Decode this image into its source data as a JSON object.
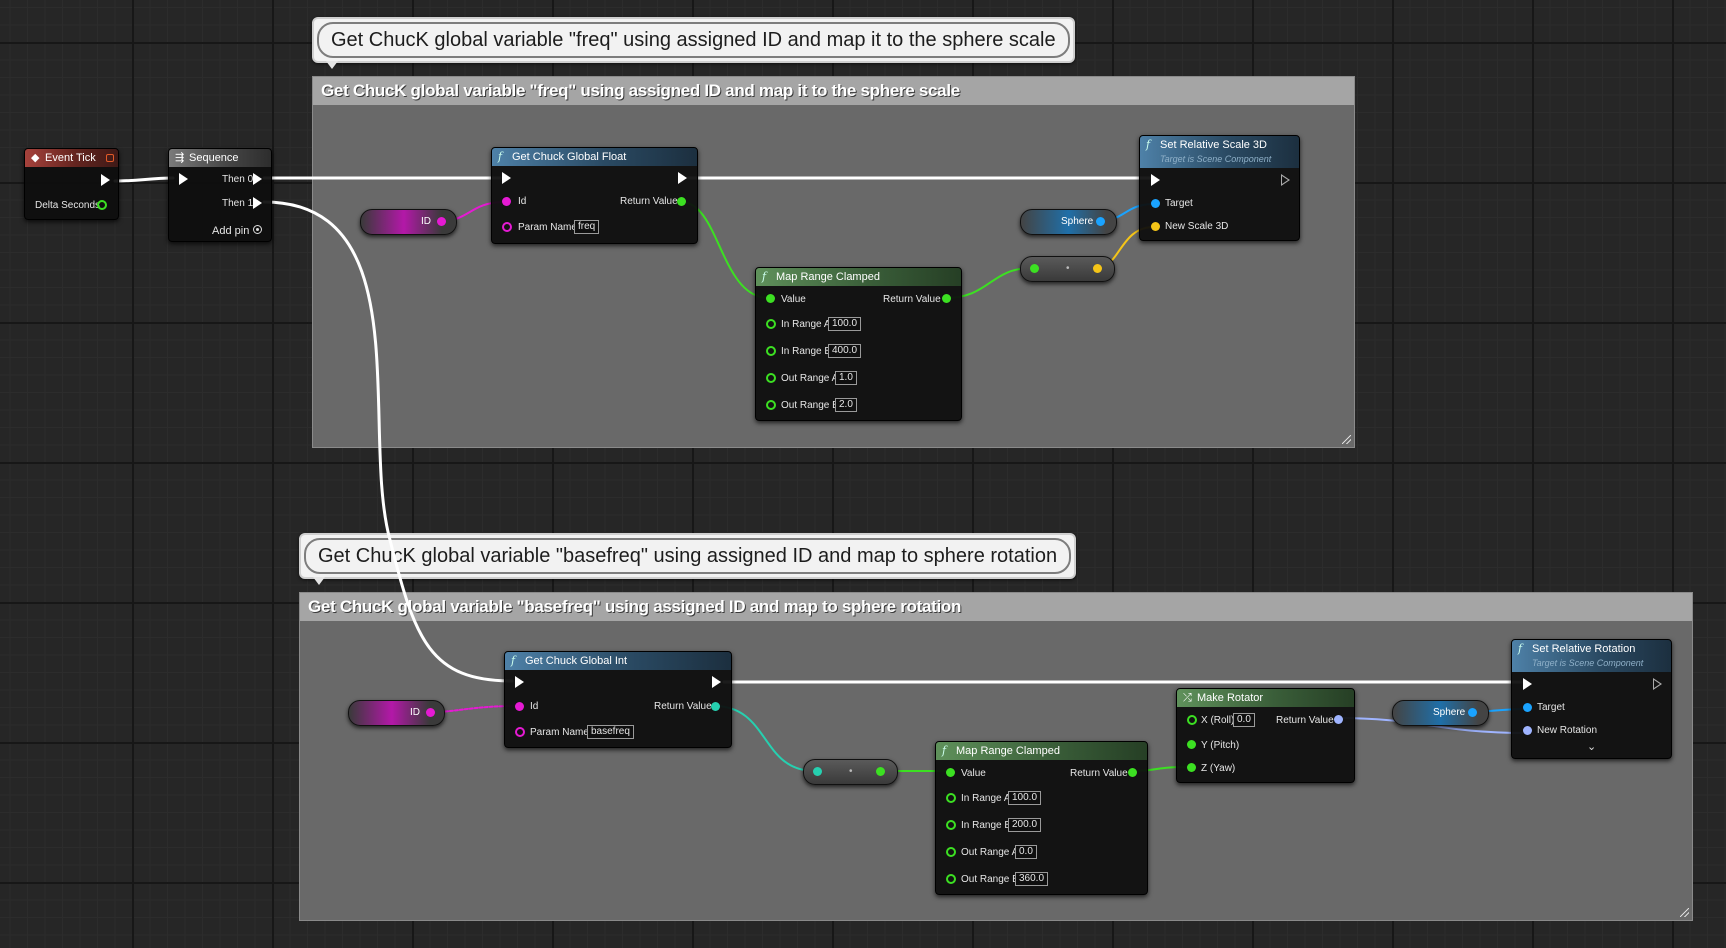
{
  "comments": {
    "top": {
      "bubble": "Get ChucK global variable \"freq\" using assigned ID and map it to the sphere scale",
      "title": "Get ChucK global variable \"freq\" using assigned ID and map it to the sphere scale"
    },
    "bottom": {
      "bubble": "Get ChucK global variable \"basefreq\" using assigned ID and map to sphere rotation",
      "title": "Get ChucK global variable \"basefreq\" using assigned ID and map to sphere rotation"
    }
  },
  "event_tick": {
    "title": "Event Tick",
    "delta": "Delta Seconds"
  },
  "sequence": {
    "title": "Sequence",
    "then0": "Then 0",
    "then1": "Then 1",
    "add_pin": "Add pin"
  },
  "get_float": {
    "title": "Get Chuck Global Float",
    "id": "Id",
    "return": "Return Value",
    "param": "Param Name",
    "param_value": "freq"
  },
  "get_int": {
    "title": "Get Chuck Global Int",
    "id": "Id",
    "return": "Return Value",
    "param": "Param Name",
    "param_value": "basefreq"
  },
  "var_id": "ID",
  "var_sphere": "Sphere",
  "map_range_1": {
    "title": "Map Range Clamped",
    "value": "Value",
    "return": "Return Value",
    "in_a": "In Range A",
    "in_a_v": "100.0",
    "in_b": "In Range B",
    "in_b_v": "400.0",
    "out_a": "Out Range A",
    "out_a_v": "1.0",
    "out_b": "Out Range B",
    "out_b_v": "2.0"
  },
  "map_range_2": {
    "title": "Map Range Clamped",
    "value": "Value",
    "return": "Return Value",
    "in_a": "In Range A",
    "in_a_v": "100.0",
    "in_b": "In Range B",
    "in_b_v": "200.0",
    "out_a": "Out Range A",
    "out_a_v": "0.0",
    "out_b": "Out Range B",
    "out_b_v": "360.0"
  },
  "set_scale": {
    "title": "Set Relative Scale 3D",
    "subtitle": "Target is Scene Component",
    "target": "Target",
    "new_scale": "New Scale 3D"
  },
  "set_rotation": {
    "title": "Set Relative Rotation",
    "subtitle": "Target is Scene Component",
    "target": "Target",
    "new_rotation": "New Rotation"
  },
  "make_rotator": {
    "title": "Make Rotator",
    "x": "X (Roll)",
    "x_v": "0.0",
    "y": "Y (Pitch)",
    "z": "Z (Yaw)",
    "return": "Return Value"
  },
  "convert_dot": "•",
  "colors": {
    "exec": "#ffffff",
    "float": "#3ce022",
    "int": "#26d0b0",
    "object": "#1aa3ff",
    "vector": "#f5c518",
    "rotator": "#9fb4ff",
    "id": "#e51ad3"
  }
}
